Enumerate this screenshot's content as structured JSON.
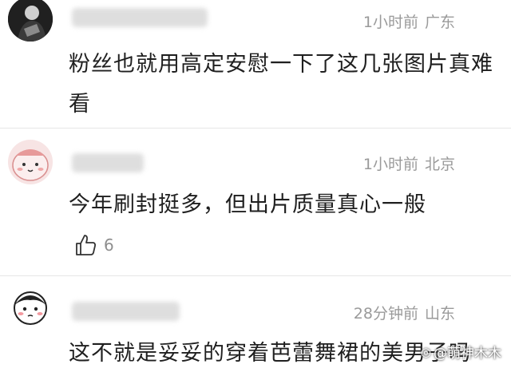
{
  "comments": [
    {
      "time": "1小时前",
      "location": "广东",
      "text_line1": "粉丝也就用高定安慰一下了这几张图片真难",
      "text_line2": "看"
    },
    {
      "time": "1小时前",
      "location": "北京",
      "text_line1": "今年刷封挺多，但出片质量真心一般",
      "like_count": "6"
    },
    {
      "time": "28分钟前",
      "location": "山东",
      "text_line1": "这不就是妥妥的穿着芭蕾舞裙的美男子吗"
    }
  ],
  "watermark": {
    "text": "@萌神木木"
  },
  "colors": {
    "meta": "#9a9a9a",
    "text": "#1f1f1f",
    "divider": "#e6e6e6"
  }
}
